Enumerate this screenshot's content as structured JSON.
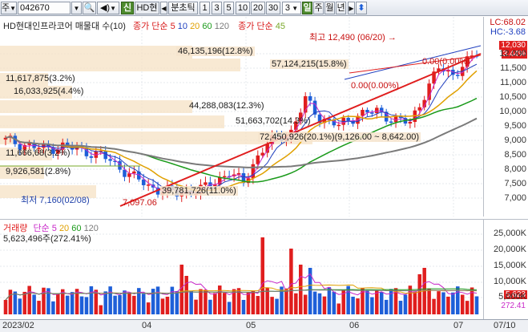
{
  "toolbar": {
    "market": "주",
    "code": "042670",
    "stock_name": "HD현",
    "mode_badge": "신",
    "period_label": "분초틱",
    "periods": [
      "1",
      "3",
      "5",
      "10",
      "20",
      "30"
    ],
    "count": "3",
    "units": [
      "일",
      "주",
      "월",
      "년"
    ]
  },
  "price_panel": {
    "title": "HD현대인프라코어 매물대 수(10)",
    "ma_label": "종가 단순",
    "ma_periods": [
      "5",
      "10",
      "20",
      "60",
      "120"
    ],
    "ma_period_extra": "45",
    "ma_colors": [
      "#d81a1a",
      "#1f3fbf",
      "#e0a000",
      "#1a9a1a",
      "#7a7a7a",
      "#9acd32"
    ],
    "high_label": "최고 12,490 (06/20)",
    "low_label": "최저 7,160(02/08)",
    "low_value_label": "7,097.06",
    "range_label": "72,450,926(20.1%)(9,126.00 ~ 8,642.00)",
    "lc_label": "LC:68.02",
    "hc_label": "HC:-3.68",
    "current_price": "12,030",
    "change_pct": "3.44%",
    "volume_profile": [
      {
        "label": "46,135,196(12.8%)",
        "row": 0
      },
      {
        "label": "57,124,215(15.8%)",
        "row": 1
      },
      {
        "label": "11,617,875(3.2%)",
        "row": 2
      },
      {
        "label": "16,033,925(4.4%)",
        "row": 3
      },
      {
        "label": "44,288,083(12.3%)",
        "row": 4
      },
      {
        "label": "51,663,702(14.3%)",
        "row": 5
      },
      {
        "label": "11,666,68(3.2%)",
        "row": 6
      },
      {
        "label": "9,926,581(2.8%)",
        "row": 7
      },
      {
        "label": "39,781,726(11.0%)",
        "row": 8
      }
    ],
    "small_labels": [
      "0.00(0.00%)",
      "0.00(0.00%)"
    ]
  },
  "price_axis": {
    "ticks": [
      "12,000",
      "11,500",
      "11,000",
      "10,500",
      "10,000",
      "9,500",
      "9,000",
      "8,500",
      "8,000",
      "7,500",
      "7,000"
    ]
  },
  "volume_panel": {
    "title": "거래량",
    "ma_label": "단순",
    "ma_periods": [
      "5",
      "20",
      "60",
      "120"
    ],
    "ma_colors": [
      "#c828c8",
      "#e0a000",
      "#1a9a1a",
      "#7a7a7a"
    ],
    "current_volume": "5,623,496주(272.41%)",
    "current_tag": "5,623",
    "pct_tag": "272.41"
  },
  "volume_axis": {
    "ticks": [
      "25,000K",
      "20,000K",
      "15,000K",
      "10,000K",
      "5,000K"
    ]
  },
  "date_axis": {
    "ticks": [
      "2023/02",
      "04",
      "05",
      "06",
      "07",
      "07/10"
    ]
  },
  "colors": {
    "up": "#e01e1e",
    "down": "#1e5fd8",
    "profile": "#f5e1c4"
  },
  "icons": [
    "search-icon",
    "speaker-icon",
    "chevron-down-icon",
    "arrow-left-icon",
    "arrow-up-down-icon"
  ]
}
